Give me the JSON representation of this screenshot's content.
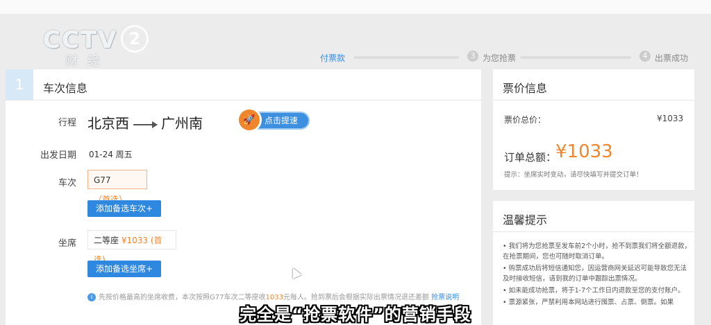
{
  "watermark": {
    "brand": "CCTV",
    "channel": "2",
    "sub": "财经"
  },
  "steps": [
    {
      "label": "付票款"
    },
    {
      "num": "3",
      "label": "为您抢票"
    },
    {
      "num": "4",
      "label": "出票成功"
    }
  ],
  "section": {
    "num": "1",
    "title": "车次信息"
  },
  "trip": {
    "route_label": "行程",
    "from": "北京西",
    "to": "广州南",
    "speed_button": "点击提速",
    "date_label": "出发日期",
    "date": "01-24 周五",
    "train_label": "车次",
    "train": "G77",
    "train_pref": "（首选）",
    "add_train": "添加备选车次+",
    "seat_label": "坐席",
    "seat": "二等座",
    "seat_price": "¥1033",
    "seat_pref": "(首选)",
    "add_seat": "添加备选坐席+",
    "note_pre": "先按价格最高的坐席收费，本次按照G77车次二等座收",
    "note_amount": "1033",
    "note_post": "元每人。抢到票后会根据实际出票情况退还差额",
    "note_link": "抢票说明"
  },
  "price": {
    "title": "票价信息",
    "total_label": "票价总价：",
    "total": "¥1033",
    "order_label": "订单总额：",
    "order": "¥1033",
    "hint": "提示：坐席实时变动，请尽快填写并提交订单！"
  },
  "tips": {
    "title": "温馨提示",
    "items": [
      "• 我们将为您抢票至发车前2个小时，抢不到票我们将全额退款，在抢票期间，您也可随时取消订单。",
      "• 购票成功后将短信通知您，因运营商网关延迟可能导致您无法及时接收短信，请到我的订单中跟踪出票情况。",
      "• 如未能成功抢票，将于1-7个工作日内退款至您的支付账户。",
      "• 票源紧张，严禁利用本网站进行囤票、占票、倒票。如果"
    ]
  },
  "subtitle": "完全是“抢票软件”的营销手段",
  "colors": {
    "accent": "#2e88e0",
    "price": "#f0862b"
  }
}
